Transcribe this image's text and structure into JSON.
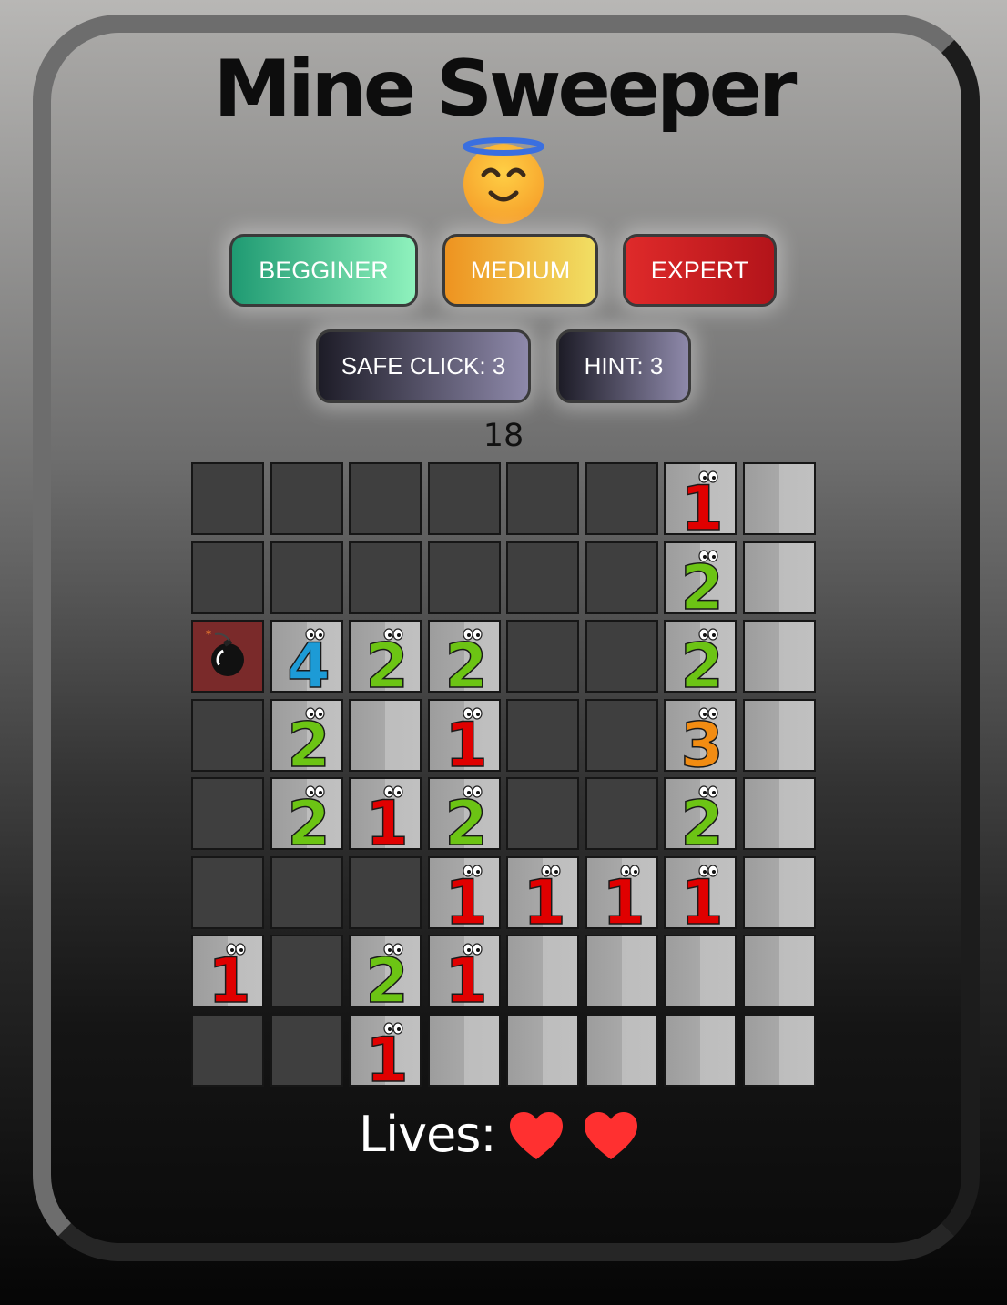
{
  "title": "Mine Sweeper",
  "smiley": {
    "icon": "angel-face-icon"
  },
  "buttons": {
    "beginner": "BEGGINER",
    "medium": "MEDIUM",
    "expert": "EXPERT",
    "safe_click": "SAFE CLICK: 3",
    "hint": "HINT: 3"
  },
  "timer": "18",
  "board": {
    "rows": [
      [
        "h",
        "h",
        "h",
        "h",
        "h",
        "h",
        "1",
        "0"
      ],
      [
        "h",
        "h",
        "h",
        "h",
        "h",
        "h",
        "2",
        "0"
      ],
      [
        "mine",
        "4",
        "2",
        "2",
        "h",
        "h",
        "2",
        "0"
      ],
      [
        "h",
        "2",
        "0",
        "1",
        "h",
        "h",
        "3",
        "0"
      ],
      [
        "h",
        "2",
        "1",
        "2",
        "h",
        "h",
        "2",
        "0"
      ],
      [
        "h",
        "h",
        "h",
        "1",
        "1",
        "1",
        "1",
        "0"
      ],
      [
        "1",
        "h",
        "2",
        "1",
        "0",
        "0",
        "0",
        "0"
      ],
      [
        "h",
        "h",
        "1",
        "0",
        "0",
        "0",
        "0",
        "0"
      ]
    ],
    "number_colors": {
      "1": "#e00000",
      "2": "#6cc414",
      "3": "#f28c12",
      "4": "#1d9bd6"
    }
  },
  "lives": {
    "label": "Lives:",
    "count": 2,
    "icon": "heart-icon",
    "color": "#ff3030"
  }
}
